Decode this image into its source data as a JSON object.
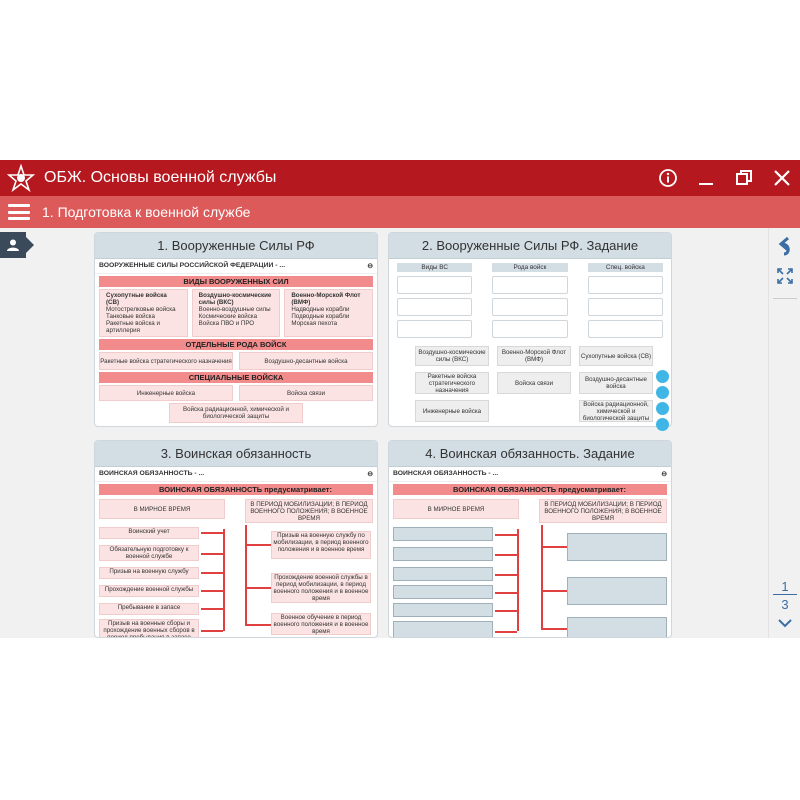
{
  "window": {
    "title": "ОБЖ. Основы военной службы"
  },
  "subheader": {
    "title": "1. Подготовка к военной службе"
  },
  "cards": {
    "c1": {
      "title": "1. Вооруженные Силы РФ",
      "header": "ВООРУЖЕННЫЕ СИЛЫ РОССИЙСКОЙ ФЕДЕРАЦИИ - ...",
      "section1": "ВИДЫ ВООРУЖЕННЫХ СИЛ",
      "col1_title": "Сухопутные войска (СВ)",
      "col1_items": [
        "Мотострелковые войска",
        "Танковые войска",
        "Ракетные войска и артиллерия"
      ],
      "col2_title": "Воздушно-космические силы (ВКС)",
      "col2_items": [
        "Военно-воздушные силы",
        "Космические войска",
        "Войска ПВО и ПРО"
      ],
      "col3_title": "Военно-Морской Флот (ВМФ)",
      "col3_items": [
        "Надводные корабли",
        "Подводные корабли",
        "Морская пехота"
      ],
      "section2": "ОТДЕЛЬНЫЕ РОДА ВОЙСК",
      "sep1": "Ракетные войска стратегического назначения",
      "sep2": "Воздушно-десантные войска",
      "section3": "СПЕЦИАЛЬНЫЕ ВОЙСКА",
      "spec1": "Инженерные войска",
      "spec2": "Войска связи",
      "spec3": "Войска радиационной, химической и биологической защиты"
    },
    "c2": {
      "title": "2. Вооруженные Силы РФ. Задание",
      "col_headers": [
        "Виды ВС",
        "Рода войск",
        "Спец. войска"
      ],
      "options": [
        "Воздушно-космические силы (ВКС)",
        "Военно-Морской Флот (ВМФ)",
        "Сухопутные войска (СВ)",
        "Ракетные войска стратегического назначения",
        "Войска связи",
        "Воздушно-десантные войска",
        "Инженерные войска",
        "Войска радиационной, химической и биологической защиты"
      ]
    },
    "c3": {
      "title": "3. Воинская обязанность",
      "header": "ВОИНСКАЯ ОБЯЗАННОСТЬ - ...",
      "bar": "ВОИНСКАЯ ОБЯЗАННОСТЬ предусматривает:",
      "left_head": "В МИРНОЕ ВРЕМЯ",
      "right_head": "В ПЕРИОД МОБИЛИЗАЦИИ; В ПЕРИОД ВОЕННОГО ПОЛОЖЕНИЯ; В ВОЕННОЕ ВРЕМЯ",
      "left_items": [
        "Воинский учет",
        "Обязательную подготовку к военной службе",
        "Призыв на военную службу",
        "Прохождение военной службы",
        "Пребывание в запасе",
        "Призыв на военные сборы и прохождение военных сборов в период пребывания в запасе"
      ],
      "right_items": [
        "Призыв на военную службу по мобилизации, в период военного положения и в военное время",
        "Прохождение военной службы в период мобилизации, в период военного положения и в военное время",
        "Военное обучение в период военного положения и в военное время"
      ]
    },
    "c4": {
      "title": "4. Воинская обязанность. Задание",
      "header": "ВОИНСКАЯ ОБЯЗАННОСТЬ - ...",
      "bar": "ВОИНСКАЯ ОБЯЗАННОСТЬ предусматривает:",
      "left_head": "В МИРНОЕ ВРЕМЯ",
      "right_head": "В ПЕРИОД МОБИЛИЗАЦИИ; В ПЕРИОД ВОЕННОГО ПОЛОЖЕНИЯ; В ВОЕННОЕ ВРЕМЯ"
    }
  },
  "pager": {
    "current": "1",
    "total": "3"
  },
  "colors": {
    "titlebar": "#b5191f",
    "subbar": "#dd5a5a",
    "accent": "#3b6ea5"
  },
  "icons": [
    "emblem-icon",
    "info-icon",
    "minimize-icon",
    "restore-icon",
    "close-icon",
    "menu-icon",
    "user-icon",
    "back-icon",
    "expand-icon",
    "chevron-down-icon"
  ]
}
